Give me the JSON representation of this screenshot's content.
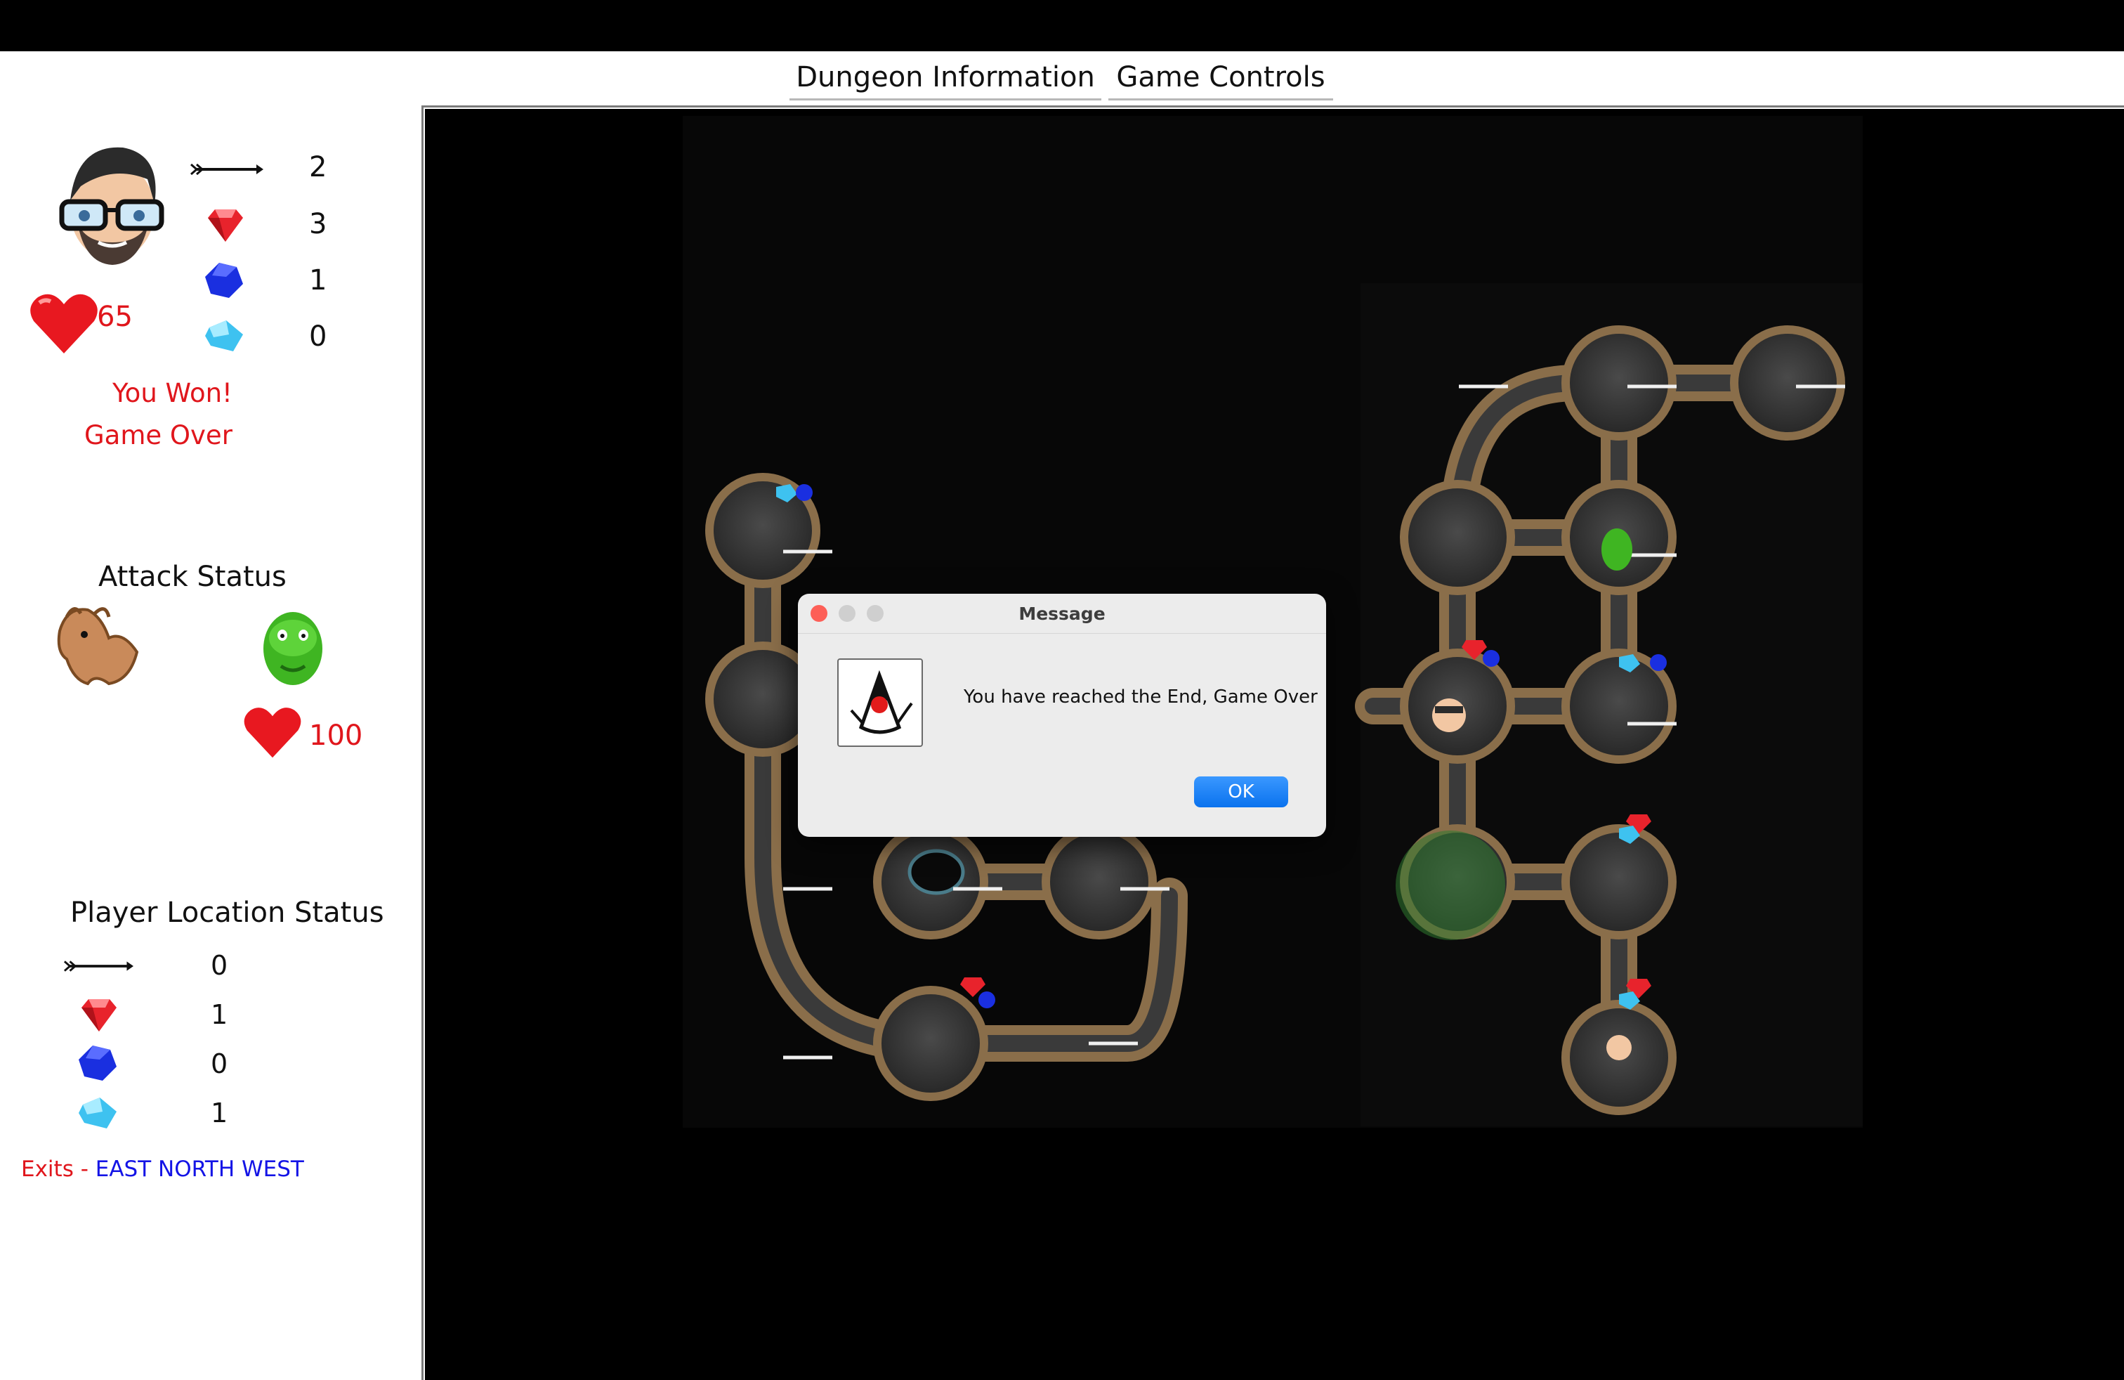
{
  "menu": {
    "dungeon_info": "Dungeon Information",
    "game_controls": "Game Controls"
  },
  "player": {
    "health": "65",
    "arrows": "2",
    "rubies": "3",
    "sapphires": "1",
    "diamonds": "0",
    "status_line1": "You Won!",
    "status_line2": "Game Over"
  },
  "attack": {
    "title": "Attack Status",
    "monster_health": "100"
  },
  "location": {
    "title": "Player Location Status",
    "arrows": "0",
    "rubies": "1",
    "sapphires": "0",
    "diamonds": "1",
    "exits_label": "Exits - ",
    "exits_value": "EAST NORTH WEST"
  },
  "dialog": {
    "title": "Message",
    "message": "You have reached the End, Game Over",
    "ok_label": "OK"
  },
  "colors": {
    "status_red": "#e0161c",
    "exits_blue": "#1414e6",
    "ok_blue": "#0a72ee"
  },
  "icons": [
    "arrow-icon",
    "ruby-icon",
    "sapphire-icon",
    "diamond-icon",
    "heart-icon",
    "player-avatar",
    "otyugh-icon",
    "monster-icon",
    "java-duke-icon"
  ]
}
